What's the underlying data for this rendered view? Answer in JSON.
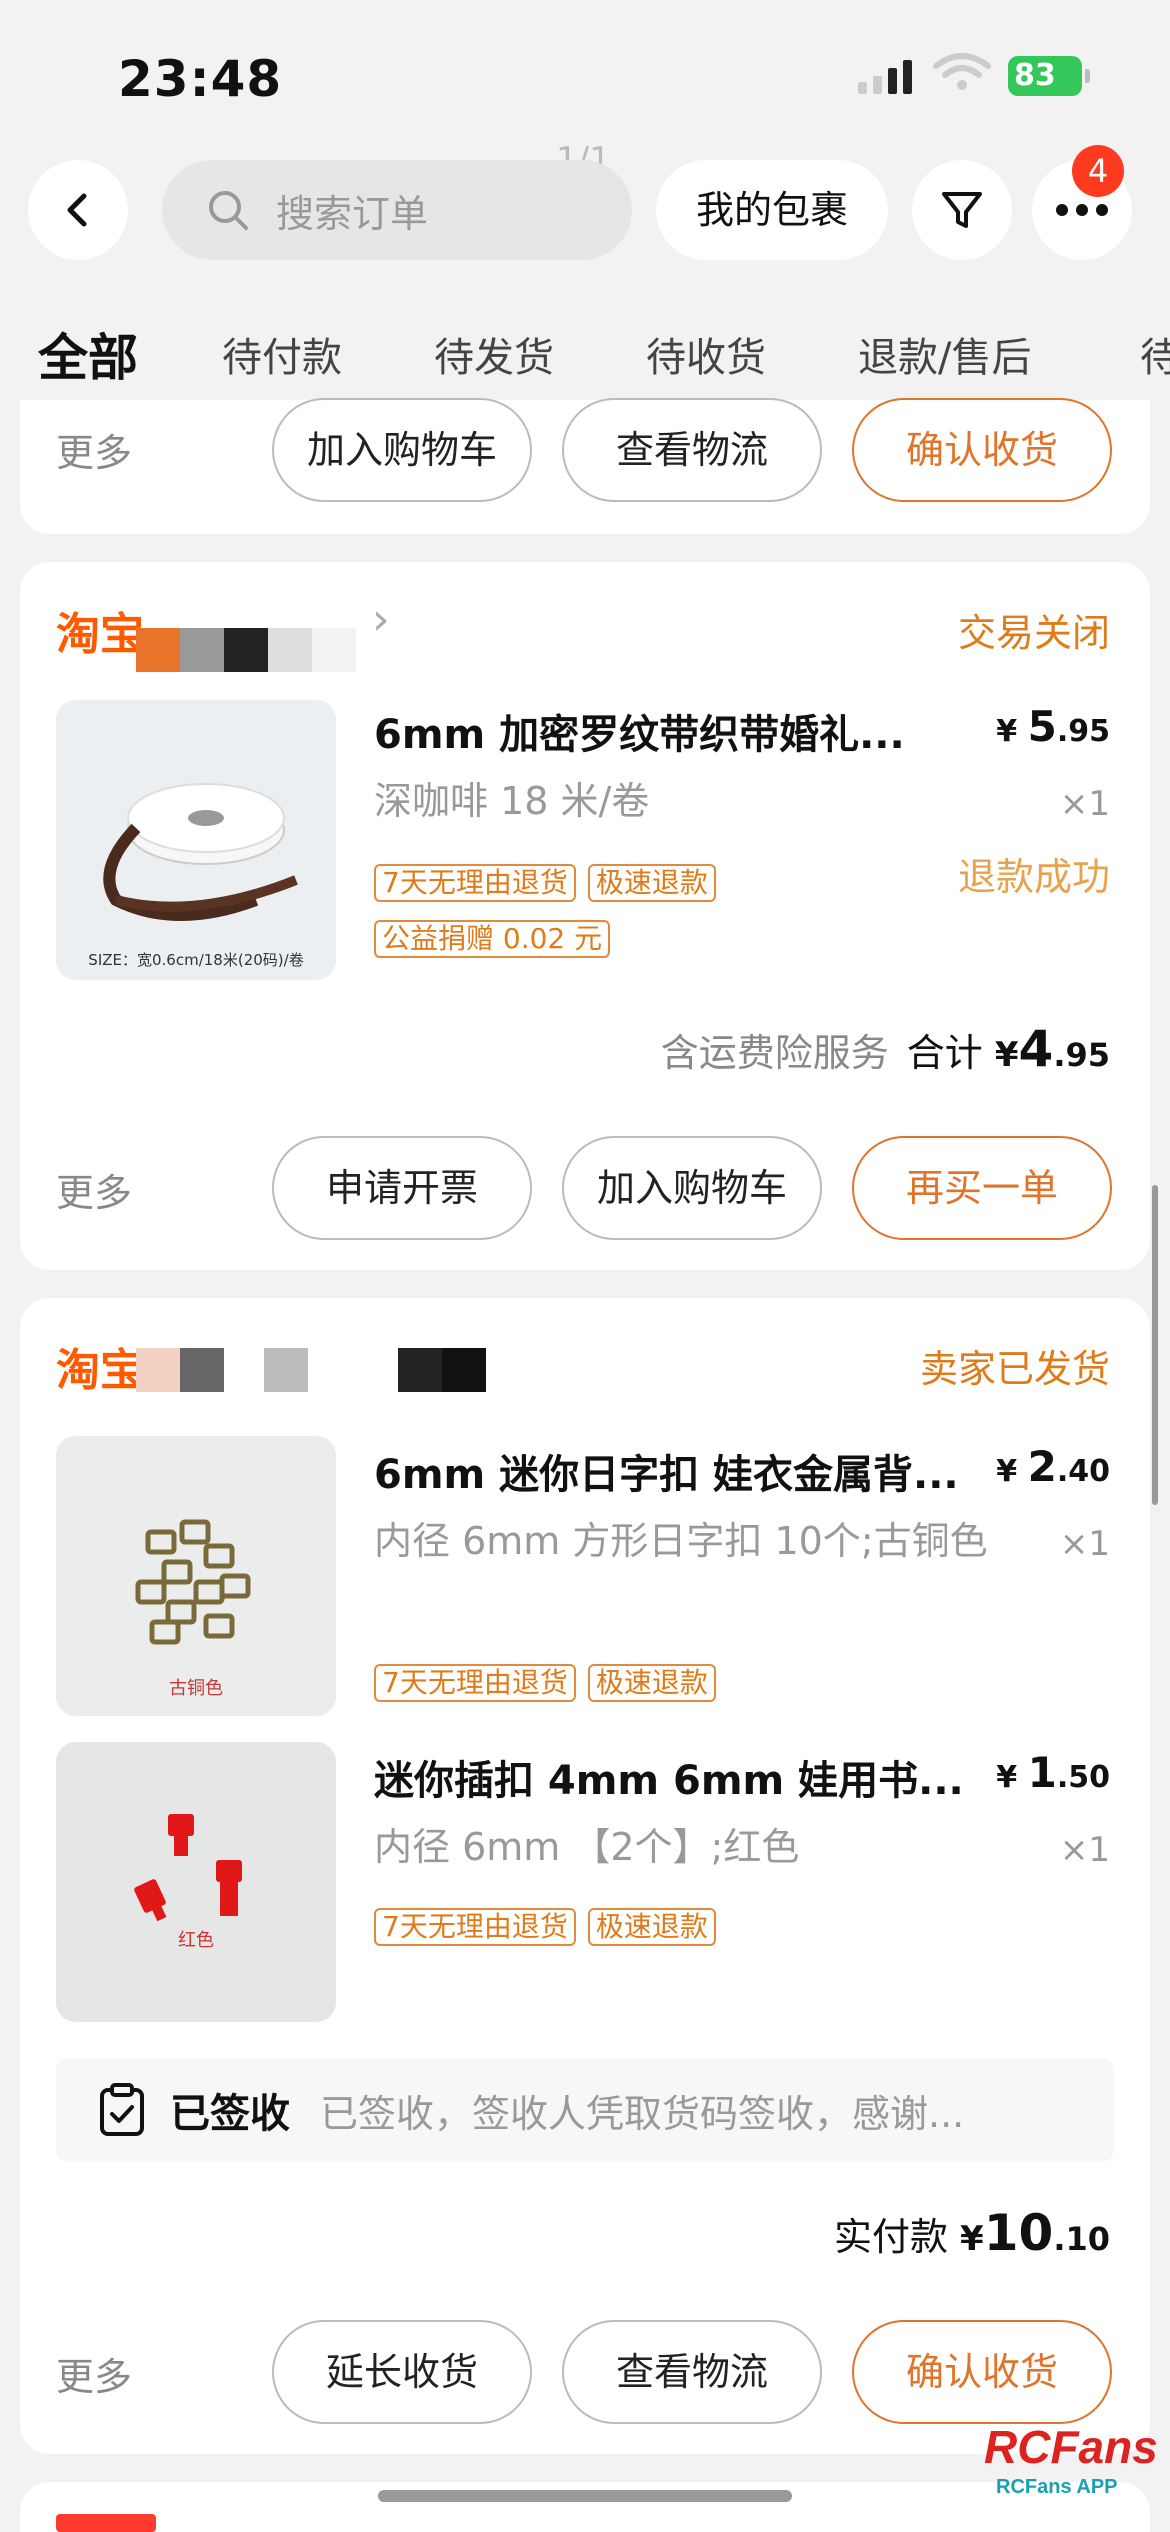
{
  "status_bar": {
    "time": "23:48",
    "battery": "83"
  },
  "page_indicator": "1/1",
  "header": {
    "search_placeholder": "搜索订单",
    "packages_label": "我的包裹",
    "more_badge": "4"
  },
  "tabs": [
    "全部",
    "待付款",
    "待发货",
    "待收货",
    "退款/售后",
    "待"
  ],
  "order0": {
    "more": "更多",
    "buttons": [
      "加入购物车",
      "查看物流",
      "确认收货"
    ]
  },
  "order1": {
    "brand": "淘宝",
    "status": "交易关闭",
    "item": {
      "title": "6mm 加密罗纹带织带婚礼...",
      "spec": "深咖啡 18 米/卷",
      "price_yen": "¥",
      "price_int": "5",
      "price_dec": ".95",
      "qty": "×1",
      "tags": [
        "7天无理由退货",
        "极速退款"
      ],
      "charity": "公益捐赠 0.02 元",
      "refund_status": "退款成功",
      "thumb_caption": "SIZE：宽0.6cm/18米(20码)/卷"
    },
    "total": {
      "note": "含运费险服务",
      "label": "合计",
      "yen": "¥",
      "int": "4",
      "dec": ".95"
    },
    "more": "更多",
    "buttons": [
      "申请开票",
      "加入购物车",
      "再买一单"
    ]
  },
  "order2": {
    "brand": "淘宝",
    "status": "卖家已发货",
    "items": [
      {
        "title": "6mm 迷你日字扣 娃衣金属背...",
        "spec": "内径 6mm 方形日字扣 10个;古铜色",
        "price_yen": "¥",
        "price_int": "2",
        "price_dec": ".40",
        "qty": "×1",
        "tags": [
          "7天无理由退货",
          "极速退款"
        ],
        "thumb_caption": "古铜色"
      },
      {
        "title": "迷你插扣 4mm 6mm 娃用书...",
        "spec": "内径 6mm 【2个】;红色",
        "price_yen": "¥",
        "price_int": "1",
        "price_dec": ".50",
        "qty": "×1",
        "tags": [
          "7天无理由退货",
          "极速退款"
        ],
        "thumb_caption": "红色"
      }
    ],
    "signed": {
      "title": "已签收",
      "message": "已签收，签收人凭取货码签收，感谢..."
    },
    "total": {
      "label": "实付款",
      "yen": "¥",
      "int": "10",
      "dec": ".10"
    },
    "more": "更多",
    "buttons": [
      "延长收货",
      "查看物流",
      "确认收货"
    ]
  },
  "watermark": {
    "logo": "RCFans",
    "app": "RCFans APP"
  },
  "colors": {
    "accent": "#e0742a",
    "brand": "#ff5a00",
    "badge": "#ff3b1f",
    "battery": "#34c759"
  }
}
